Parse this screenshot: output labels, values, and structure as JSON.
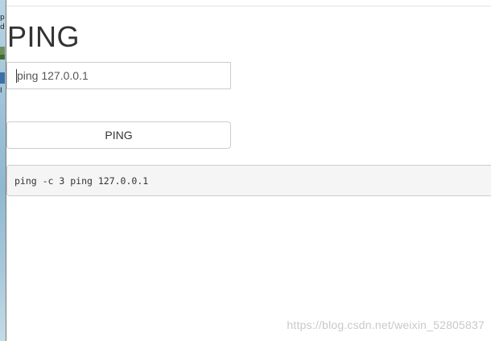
{
  "desktop": {
    "glyphs": [
      "p",
      "d",
      "I"
    ]
  },
  "page": {
    "title": "PING"
  },
  "form": {
    "input_value": "ping 127.0.0.1",
    "button_label": "PING"
  },
  "output": {
    "text": "ping -c 3 ping 127.0.0.1"
  },
  "watermark": {
    "text": "https://blog.csdn.net/weixin_52805837"
  }
}
